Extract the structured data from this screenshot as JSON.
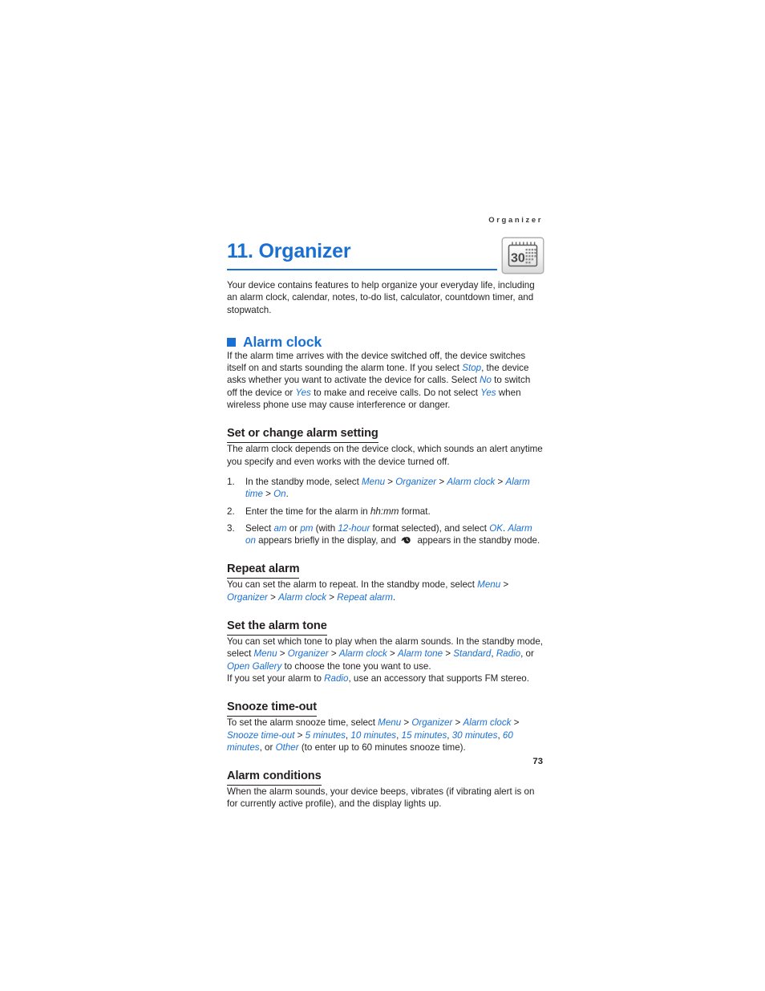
{
  "running_header": "Organizer",
  "chapter": {
    "title": "11. Organizer",
    "icon": "calendar-30-icon",
    "icon_day": "30",
    "accent_color": "#1a6fd2"
  },
  "intro": {
    "text_1": "Your device contains features to help organize your everyday life, including an ",
    "text_2": "alarm clock, calendar, notes, to-do list, calculator, countdown timer, and stopwatch."
  },
  "section_alarm_clock": {
    "heading": "Alarm clock",
    "bullet": "blue-square-bullet",
    "intro_parts": {
      "p1": "If the alarm time arrives with the device switched off, the device switches itself on and starts sounding the alarm tone. If you select ",
      "ui_stop": "Stop",
      "p2": ", the device asks whether you want to activate the device for calls. Select ",
      "ui_no": "No",
      "p3": " to switch off the device or ",
      "ui_yes_1": "Yes",
      "p4": " to make and receive calls. Do not select ",
      "ui_yes_2": "Yes",
      "p5": " when wireless phone use may cause interference or danger."
    }
  },
  "sub_set_alarm": {
    "heading": "Set or change alarm setting",
    "body": "The alarm clock depends on the device clock, which sounds an alert anytime you specify and even works with the device turned off.",
    "steps": [
      {
        "num": "1.",
        "parts": {
          "t1": "In the standby mode, select ",
          "ui1": "Menu",
          "s1": " > ",
          "ui2": "Organizer",
          "s2": " > ",
          "ui3": "Alarm clock",
          "s3": " > ",
          "ui4": "Alarm time",
          "s4": " > ",
          "ui5": "On",
          "t2": "."
        }
      },
      {
        "num": "2.",
        "parts": {
          "t1": "Enter the time for the alarm in ",
          "em1": "hh:mm",
          "t2": " format."
        }
      },
      {
        "num": "3.",
        "parts": {
          "t1": "Select ",
          "ui1": "am",
          "t2": " or ",
          "ui2": "pm",
          "t3": " (with ",
          "ui3": "12-hour",
          "t4": " format selected), and select ",
          "ui4": "OK",
          "t5": ". ",
          "ui5": "Alarm on",
          "t6": " appears briefly in the display, and ",
          "icon": "alarm-clock-glyph",
          "t7": " appears in the standby mode."
        }
      }
    ]
  },
  "sub_repeat_alarm": {
    "heading": "Repeat alarm",
    "parts": {
      "t1": "You can set the alarm to repeat. In the standby mode, select ",
      "ui1": "Menu",
      "s1": " > ",
      "ui2": "Organizer",
      "s2": " > ",
      "ui3": "Alarm clock",
      "s3": " > ",
      "ui4": "Repeat alarm",
      "t2": "."
    }
  },
  "sub_alarm_tone": {
    "heading": "Set the alarm tone",
    "parts": {
      "t1": "You can set which tone to play when the alarm sounds. In the standby mode, select ",
      "ui1": "Menu",
      "s1": " > ",
      "ui2": "Organizer",
      "s2": " > ",
      "ui3": "Alarm clock",
      "s3": " > ",
      "ui4": "Alarm tone",
      "s4": " > ",
      "ui5": "Standard",
      "c1": ", ",
      "ui6": "Radio",
      "t2": ", or ",
      "ui7": "Open Gallery",
      "t3": " to choose the tone you want to use."
    },
    "note_parts": {
      "t1": "If you set your alarm to ",
      "ui1": "Radio",
      "t2": ", use an accessory that supports FM stereo."
    }
  },
  "sub_snooze": {
    "heading": "Snooze time-out",
    "parts": {
      "t1": "To set the alarm snooze time, select ",
      "ui1": "Menu",
      "s1": " > ",
      "ui2": "Organizer",
      "s2": " > ",
      "ui3": "Alarm clock",
      "s3": " > ",
      "ui4": "Snooze time-out",
      "s4": " > ",
      "ui5": "5 minutes",
      "c1": ", ",
      "ui6": "10 minutes",
      "c2": ", ",
      "ui7": "15 minutes",
      "c3": ", ",
      "ui8": "30 minutes",
      "c4": ", ",
      "ui9": "60 minutes",
      "t2": ", or ",
      "ui10": "Other",
      "t3": " (to enter up to 60 minutes snooze time)."
    }
  },
  "sub_alarm_conditions": {
    "heading": "Alarm conditions",
    "body": "When the alarm sounds, your device beeps, vibrates (if vibrating alert is on for currently active profile), and the display lights up."
  },
  "folio": "73"
}
